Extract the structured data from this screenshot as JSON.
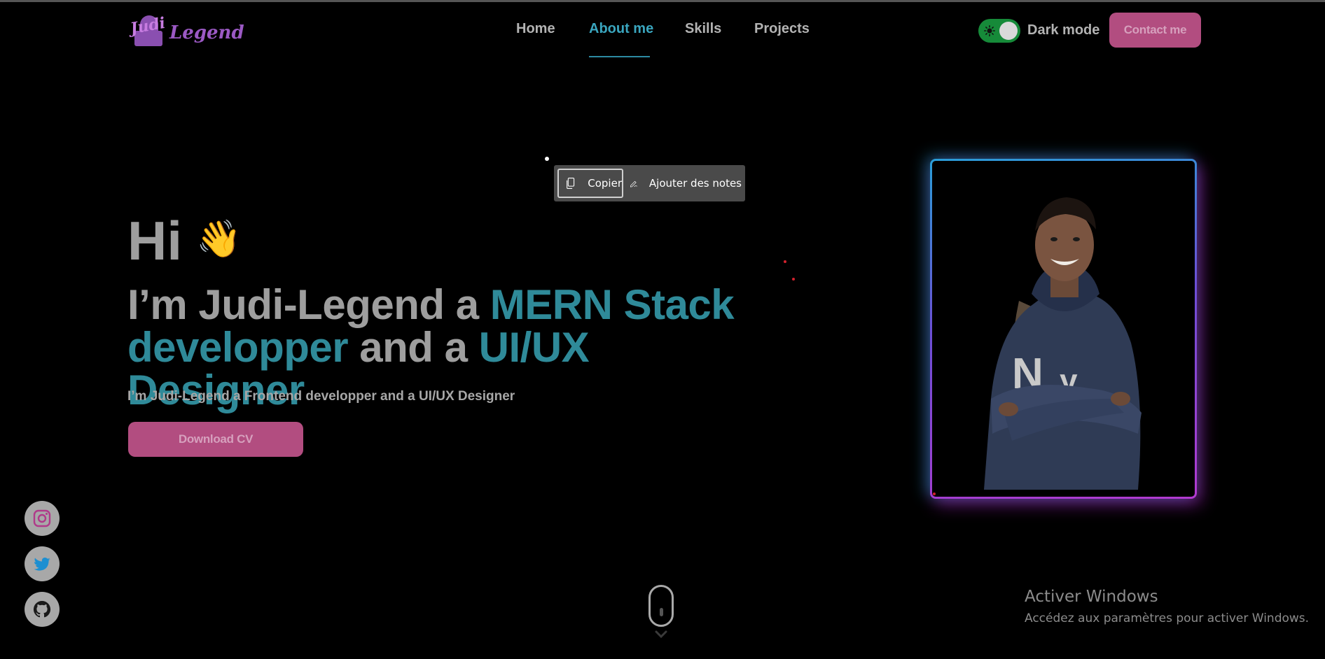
{
  "logo": {
    "mark_text": "Judi",
    "word": "Legend"
  },
  "nav": {
    "items": [
      {
        "label": "Home",
        "active": false
      },
      {
        "label": "About me",
        "active": true
      },
      {
        "label": "Skills",
        "active": false
      },
      {
        "label": "Projects",
        "active": false
      }
    ]
  },
  "theme_toggle": {
    "label": "Dark mode",
    "on": true
  },
  "contact_button": {
    "label": "Contact me"
  },
  "context_menu": {
    "copy_label": "Copier",
    "notes_label": "Ajouter des notes"
  },
  "hero": {
    "greeting": "Hi",
    "wave_emoji": "👋",
    "headline": {
      "part1": "I’m Judi-Legend a ",
      "accent1": "MERN Stack developper",
      "part2": " and a ",
      "accent2": "UI/UX Designer"
    },
    "subtitle": "I’m Judi-Legend a Frontend developper and a UI/UX Designer",
    "cv_button": "Download CV"
  },
  "social": [
    "instagram-icon",
    "twitter-icon",
    "github-icon"
  ],
  "watermark": {
    "title": "Activer Windows",
    "subtitle": "Accédez aux paramètres pour activer Windows."
  },
  "colors": {
    "accent_teal": "#2f8a99",
    "nav_active": "#3aa6bf",
    "button_pink": "#b24d80",
    "toggle_green": "#168a39",
    "logo_purple": "#9b59c4"
  }
}
